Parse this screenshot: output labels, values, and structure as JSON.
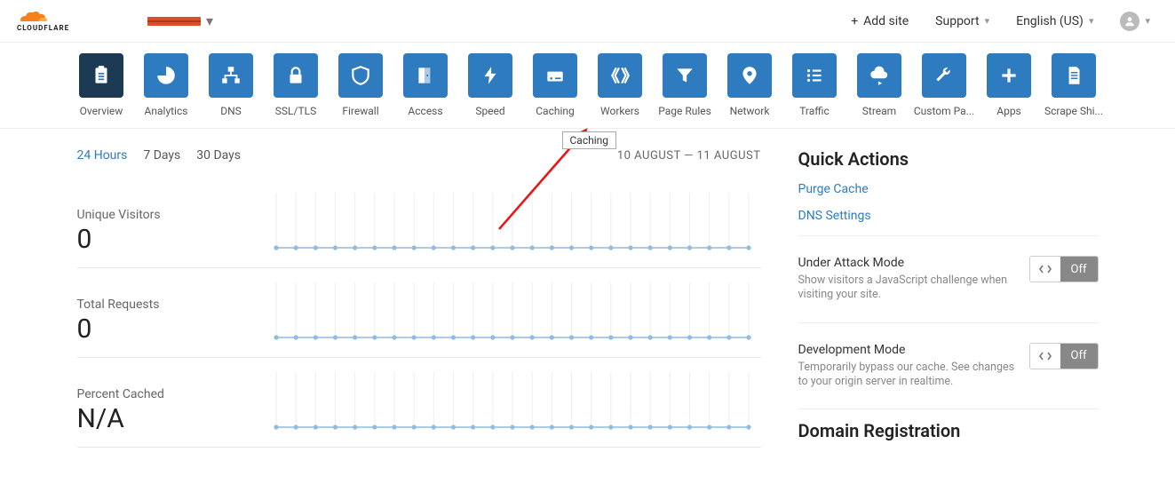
{
  "header": {
    "add_site": "Add site",
    "support": "Support",
    "language": "English (US)"
  },
  "nav": [
    {
      "label": "Overview",
      "icon": "clipboard",
      "active": true
    },
    {
      "label": "Analytics",
      "icon": "pie"
    },
    {
      "label": "DNS",
      "icon": "sitemap"
    },
    {
      "label": "SSL/TLS",
      "icon": "lock"
    },
    {
      "label": "Firewall",
      "icon": "shield"
    },
    {
      "label": "Access",
      "icon": "door"
    },
    {
      "label": "Speed",
      "icon": "bolt"
    },
    {
      "label": "Caching",
      "icon": "drive",
      "tooltip": "Caching"
    },
    {
      "label": "Workers",
      "icon": "workers"
    },
    {
      "label": "Page Rules",
      "icon": "funnel"
    },
    {
      "label": "Network",
      "icon": "marker"
    },
    {
      "label": "Traffic",
      "icon": "list"
    },
    {
      "label": "Stream",
      "icon": "cloud-play"
    },
    {
      "label": "Custom Pa...",
      "icon": "wrench"
    },
    {
      "label": "Apps",
      "icon": "plus"
    },
    {
      "label": "Scrape Shi...",
      "icon": "page"
    }
  ],
  "range": {
    "tabs": [
      "24 Hours",
      "7 Days",
      "30 Days"
    ],
    "active": 0,
    "date": "10 AUGUST — 11 AUGUST"
  },
  "metrics": [
    {
      "label": "Unique Visitors",
      "value": "0"
    },
    {
      "label": "Total Requests",
      "value": "0"
    },
    {
      "label": "Percent Cached",
      "value": "N/A"
    }
  ],
  "chart_data": [
    {
      "type": "line",
      "title": "Unique Visitors",
      "x_ticks": 25,
      "values": [
        0,
        0,
        0,
        0,
        0,
        0,
        0,
        0,
        0,
        0,
        0,
        0,
        0,
        0,
        0,
        0,
        0,
        0,
        0,
        0,
        0,
        0,
        0,
        0,
        0
      ],
      "ylim": [
        0,
        1
      ]
    },
    {
      "type": "line",
      "title": "Total Requests",
      "x_ticks": 25,
      "values": [
        0,
        0,
        0,
        0,
        0,
        0,
        0,
        0,
        0,
        0,
        0,
        0,
        0,
        0,
        0,
        0,
        0,
        0,
        0,
        0,
        0,
        0,
        0,
        0,
        0
      ],
      "ylim": [
        0,
        1
      ]
    },
    {
      "type": "line",
      "title": "Percent Cached",
      "x_ticks": 25,
      "values": [
        0,
        0,
        0,
        0,
        0,
        0,
        0,
        0,
        0,
        0,
        0,
        0,
        0,
        0,
        0,
        0,
        0,
        0,
        0,
        0,
        0,
        0,
        0,
        0,
        0
      ],
      "ylim": [
        0,
        1
      ]
    }
  ],
  "side": {
    "quick_actions": "Quick Actions",
    "purge": "Purge Cache",
    "dns": "DNS Settings",
    "under_attack_title": "Under Attack Mode",
    "under_attack_desc": "Show visitors a JavaScript challenge when visiting your site.",
    "dev_mode_title": "Development Mode",
    "dev_mode_desc": "Temporarily bypass our cache. See changes to your origin server in realtime.",
    "toggle_off": "Off",
    "domain_reg": "Domain Registration"
  }
}
